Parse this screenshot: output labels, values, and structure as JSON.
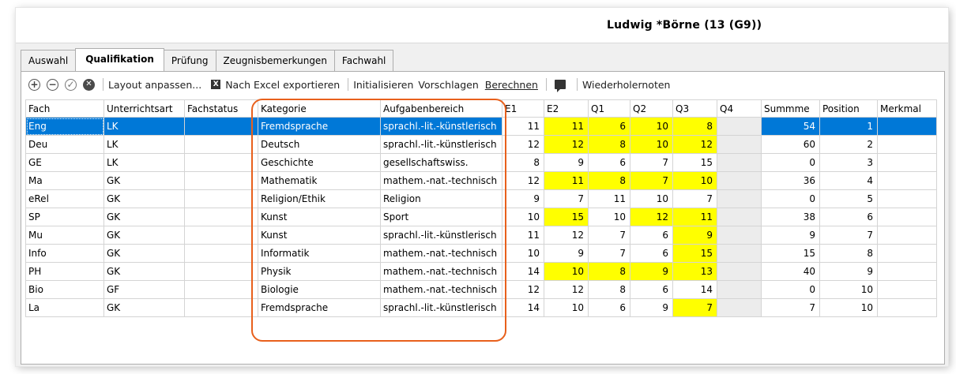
{
  "header": {
    "title": "Ludwig *Börne (13 (G9))"
  },
  "tabs": [
    {
      "label": "Auswahl",
      "active": false
    },
    {
      "label": "Qualifikation",
      "active": true
    },
    {
      "label": "Prüfung",
      "active": false
    },
    {
      "label": "Zeugnisbemerkungen",
      "active": false
    },
    {
      "label": "Fachwahl",
      "active": false
    }
  ],
  "toolbar": {
    "add_icon": "plus-circle-icon",
    "remove_icon": "minus-circle-icon",
    "confirm_icon": "check-circle-icon",
    "cancel_icon": "x-circle-icon",
    "layout": "Layout anpassen...",
    "excel_icon_glyph": "X",
    "excel": "Nach Excel exportieren",
    "initialisieren": "Initialisieren",
    "vorschlagen": "Vorschlagen",
    "berechnen": "Berechnen",
    "comment_icon": "comment-icon",
    "wiederholer": "Wiederholernoten"
  },
  "glyphs": {
    "plus": "+",
    "minus": "−",
    "check": "✓",
    "cross": "✕"
  },
  "table": {
    "columns": [
      "Fach",
      "Unterrichtsart",
      "Fachstatus",
      "Kategorie",
      "Aufgabenbereich",
      "E1",
      "E2",
      "Q1",
      "Q2",
      "Q3",
      "Q4",
      "Summme",
      "Position",
      "Merkmal"
    ],
    "rows": [
      {
        "fach": "Eng",
        "art": "LK",
        "status": "",
        "kategorie": "Fremdsprache",
        "bereich": "sprachl.-lit.-künstlerisch",
        "e1": "11",
        "e2": "11",
        "q1": "6",
        "q2": "10",
        "q3": "8",
        "q4": "",
        "summe": "54",
        "position": "1",
        "merkmal": ""
      },
      {
        "fach": "Deu",
        "art": "LK",
        "status": "",
        "kategorie": "Deutsch",
        "bereich": "sprachl.-lit.-künstlerisch",
        "e1": "12",
        "e2": "12",
        "q1": "8",
        "q2": "10",
        "q3": "12",
        "q4": "",
        "summe": "60",
        "position": "2",
        "merkmal": ""
      },
      {
        "fach": "GE",
        "art": "LK",
        "status": "",
        "kategorie": "Geschichte",
        "bereich": "gesellschaftswiss.",
        "e1": "8",
        "e2": "9",
        "q1": "6",
        "q2": "7",
        "q3": "15",
        "q4": "",
        "summe": "0",
        "position": "3",
        "merkmal": ""
      },
      {
        "fach": "Ma",
        "art": "GK",
        "status": "",
        "kategorie": "Mathematik",
        "bereich": "mathem.-nat.-technisch",
        "e1": "12",
        "e2": "11",
        "q1": "8",
        "q2": "7",
        "q3": "10",
        "q4": "",
        "summe": "36",
        "position": "4",
        "merkmal": ""
      },
      {
        "fach": "eRel",
        "art": "GK",
        "status": "",
        "kategorie": "Religion/Ethik",
        "bereich": "Religion",
        "e1": "9",
        "e2": "7",
        "q1": "11",
        "q2": "10",
        "q3": "7",
        "q4": "",
        "summe": "0",
        "position": "5",
        "merkmal": ""
      },
      {
        "fach": "SP",
        "art": "GK",
        "status": "",
        "kategorie": "Kunst",
        "bereich": "Sport",
        "e1": "10",
        "e2": "15",
        "q1": "10",
        "q2": "12",
        "q3": "11",
        "q4": "",
        "summe": "38",
        "position": "6",
        "merkmal": ""
      },
      {
        "fach": "Mu",
        "art": "GK",
        "status": "",
        "kategorie": "Kunst",
        "bereich": "sprachl.-lit.-künstlerisch",
        "e1": "11",
        "e2": "12",
        "q1": "7",
        "q2": "6",
        "q3": "9",
        "q4": "",
        "summe": "9",
        "position": "7",
        "merkmal": ""
      },
      {
        "fach": "Info",
        "art": "GK",
        "status": "",
        "kategorie": "Informatik",
        "bereich": "mathem.-nat.-technisch",
        "e1": "10",
        "e2": "9",
        "q1": "7",
        "q2": "6",
        "q3": "15",
        "q4": "",
        "summe": "15",
        "position": "8",
        "merkmal": ""
      },
      {
        "fach": "PH",
        "art": "GK",
        "status": "",
        "kategorie": "Physik",
        "bereich": "mathem.-nat.-technisch",
        "e1": "14",
        "e2": "10",
        "q1": "8",
        "q2": "9",
        "q3": "13",
        "q4": "",
        "summe": "40",
        "position": "9",
        "merkmal": ""
      },
      {
        "fach": "Bio",
        "art": "GF",
        "status": "",
        "kategorie": "Biologie",
        "bereich": "mathem.-nat.-technisch",
        "e1": "12",
        "e2": "12",
        "q1": "8",
        "q2": "6",
        "q3": "14",
        "q4": "",
        "summe": "0",
        "position": "10",
        "merkmal": ""
      },
      {
        "fach": "La",
        "art": "GK",
        "status": "",
        "kategorie": "Fremdsprache",
        "bereich": "sprachl.-lit.-künstlerisch",
        "e1": "14",
        "e2": "10",
        "q1": "6",
        "q2": "9",
        "q3": "7",
        "q4": "",
        "summe": "7",
        "position": "10",
        "merkmal": ""
      }
    ]
  },
  "colors": {
    "selection": "#0078d7",
    "highlight_cell": "#ffff00",
    "annotation": "#e8601c"
  }
}
